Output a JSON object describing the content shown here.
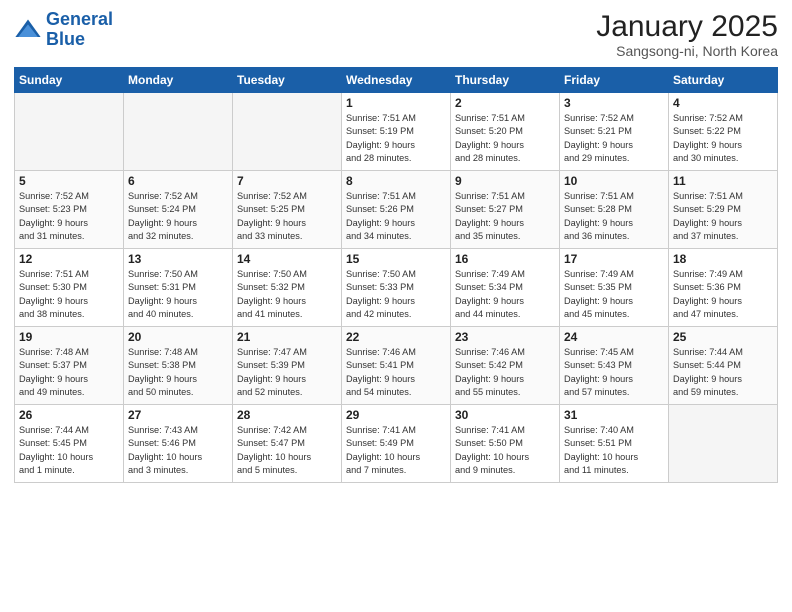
{
  "logo": {
    "line1": "General",
    "line2": "Blue"
  },
  "header": {
    "month": "January 2025",
    "location": "Sangsong-ni, North Korea"
  },
  "weekdays": [
    "Sunday",
    "Monday",
    "Tuesday",
    "Wednesday",
    "Thursday",
    "Friday",
    "Saturday"
  ],
  "weeks": [
    [
      {
        "day": "",
        "info": ""
      },
      {
        "day": "",
        "info": ""
      },
      {
        "day": "",
        "info": ""
      },
      {
        "day": "1",
        "info": "Sunrise: 7:51 AM\nSunset: 5:19 PM\nDaylight: 9 hours\nand 28 minutes."
      },
      {
        "day": "2",
        "info": "Sunrise: 7:51 AM\nSunset: 5:20 PM\nDaylight: 9 hours\nand 28 minutes."
      },
      {
        "day": "3",
        "info": "Sunrise: 7:52 AM\nSunset: 5:21 PM\nDaylight: 9 hours\nand 29 minutes."
      },
      {
        "day": "4",
        "info": "Sunrise: 7:52 AM\nSunset: 5:22 PM\nDaylight: 9 hours\nand 30 minutes."
      }
    ],
    [
      {
        "day": "5",
        "info": "Sunrise: 7:52 AM\nSunset: 5:23 PM\nDaylight: 9 hours\nand 31 minutes."
      },
      {
        "day": "6",
        "info": "Sunrise: 7:52 AM\nSunset: 5:24 PM\nDaylight: 9 hours\nand 32 minutes."
      },
      {
        "day": "7",
        "info": "Sunrise: 7:52 AM\nSunset: 5:25 PM\nDaylight: 9 hours\nand 33 minutes."
      },
      {
        "day": "8",
        "info": "Sunrise: 7:51 AM\nSunset: 5:26 PM\nDaylight: 9 hours\nand 34 minutes."
      },
      {
        "day": "9",
        "info": "Sunrise: 7:51 AM\nSunset: 5:27 PM\nDaylight: 9 hours\nand 35 minutes."
      },
      {
        "day": "10",
        "info": "Sunrise: 7:51 AM\nSunset: 5:28 PM\nDaylight: 9 hours\nand 36 minutes."
      },
      {
        "day": "11",
        "info": "Sunrise: 7:51 AM\nSunset: 5:29 PM\nDaylight: 9 hours\nand 37 minutes."
      }
    ],
    [
      {
        "day": "12",
        "info": "Sunrise: 7:51 AM\nSunset: 5:30 PM\nDaylight: 9 hours\nand 38 minutes."
      },
      {
        "day": "13",
        "info": "Sunrise: 7:50 AM\nSunset: 5:31 PM\nDaylight: 9 hours\nand 40 minutes."
      },
      {
        "day": "14",
        "info": "Sunrise: 7:50 AM\nSunset: 5:32 PM\nDaylight: 9 hours\nand 41 minutes."
      },
      {
        "day": "15",
        "info": "Sunrise: 7:50 AM\nSunset: 5:33 PM\nDaylight: 9 hours\nand 42 minutes."
      },
      {
        "day": "16",
        "info": "Sunrise: 7:49 AM\nSunset: 5:34 PM\nDaylight: 9 hours\nand 44 minutes."
      },
      {
        "day": "17",
        "info": "Sunrise: 7:49 AM\nSunset: 5:35 PM\nDaylight: 9 hours\nand 45 minutes."
      },
      {
        "day": "18",
        "info": "Sunrise: 7:49 AM\nSunset: 5:36 PM\nDaylight: 9 hours\nand 47 minutes."
      }
    ],
    [
      {
        "day": "19",
        "info": "Sunrise: 7:48 AM\nSunset: 5:37 PM\nDaylight: 9 hours\nand 49 minutes."
      },
      {
        "day": "20",
        "info": "Sunrise: 7:48 AM\nSunset: 5:38 PM\nDaylight: 9 hours\nand 50 minutes."
      },
      {
        "day": "21",
        "info": "Sunrise: 7:47 AM\nSunset: 5:39 PM\nDaylight: 9 hours\nand 52 minutes."
      },
      {
        "day": "22",
        "info": "Sunrise: 7:46 AM\nSunset: 5:41 PM\nDaylight: 9 hours\nand 54 minutes."
      },
      {
        "day": "23",
        "info": "Sunrise: 7:46 AM\nSunset: 5:42 PM\nDaylight: 9 hours\nand 55 minutes."
      },
      {
        "day": "24",
        "info": "Sunrise: 7:45 AM\nSunset: 5:43 PM\nDaylight: 9 hours\nand 57 minutes."
      },
      {
        "day": "25",
        "info": "Sunrise: 7:44 AM\nSunset: 5:44 PM\nDaylight: 9 hours\nand 59 minutes."
      }
    ],
    [
      {
        "day": "26",
        "info": "Sunrise: 7:44 AM\nSunset: 5:45 PM\nDaylight: 10 hours\nand 1 minute."
      },
      {
        "day": "27",
        "info": "Sunrise: 7:43 AM\nSunset: 5:46 PM\nDaylight: 10 hours\nand 3 minutes."
      },
      {
        "day": "28",
        "info": "Sunrise: 7:42 AM\nSunset: 5:47 PM\nDaylight: 10 hours\nand 5 minutes."
      },
      {
        "day": "29",
        "info": "Sunrise: 7:41 AM\nSunset: 5:49 PM\nDaylight: 10 hours\nand 7 minutes."
      },
      {
        "day": "30",
        "info": "Sunrise: 7:41 AM\nSunset: 5:50 PM\nDaylight: 10 hours\nand 9 minutes."
      },
      {
        "day": "31",
        "info": "Sunrise: 7:40 AM\nSunset: 5:51 PM\nDaylight: 10 hours\nand 11 minutes."
      },
      {
        "day": "",
        "info": ""
      }
    ]
  ]
}
